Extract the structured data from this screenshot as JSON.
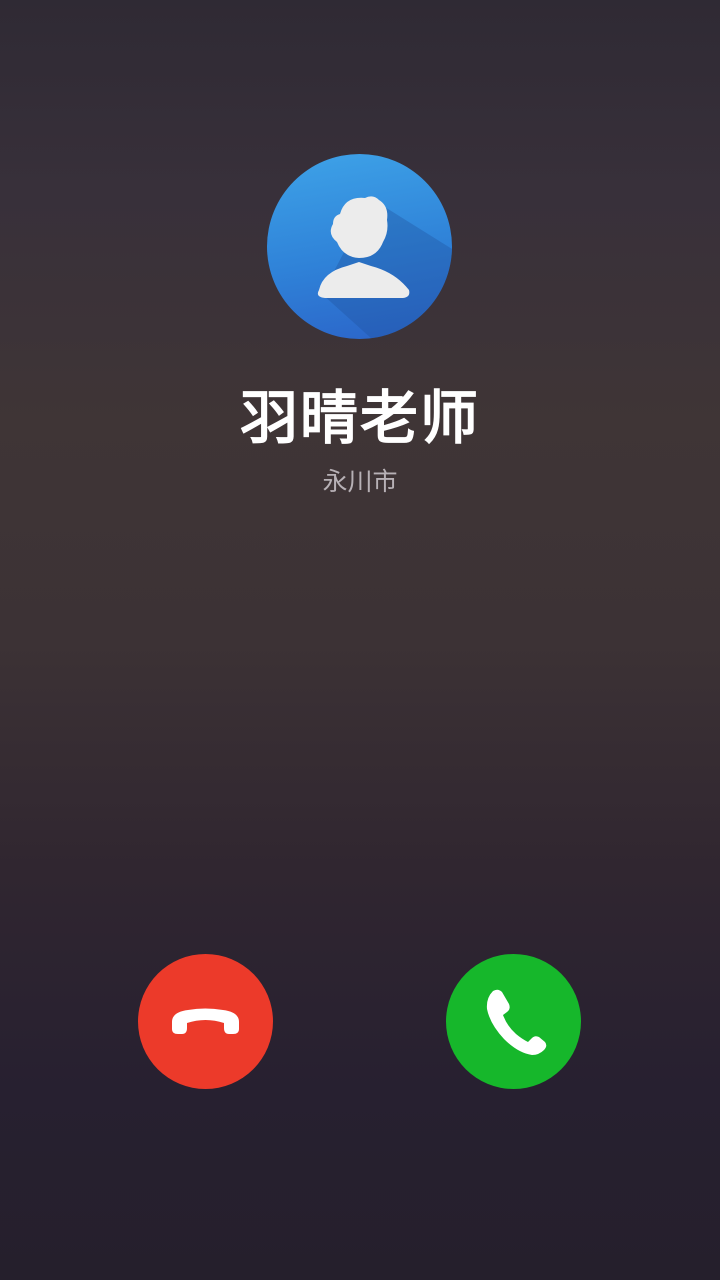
{
  "caller": {
    "name": "羽晴老师",
    "location": "永川市",
    "avatar_icon": "default-person-icon"
  },
  "actions": {
    "decline_icon": "hang-up-icon",
    "accept_icon": "phone-icon"
  },
  "colors": {
    "background_top": "#2f2a34",
    "background_bottom": "#251f2c",
    "avatar_blue": "#2f82d8",
    "decline_red": "#ec3a2a",
    "accept_green": "#16b72b",
    "name_text": "#ffffff",
    "location_text": "#b7b1b6"
  }
}
